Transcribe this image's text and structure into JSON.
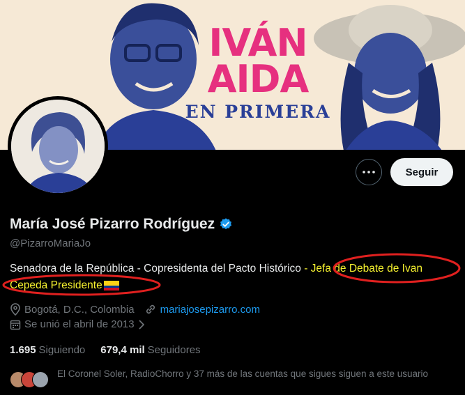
{
  "banner": {
    "line1": "IVÁN",
    "line2": "AIDA",
    "line3": "EN PRIMERA"
  },
  "actions": {
    "more_icon": "ellipsis-icon",
    "follow_label": "Seguir"
  },
  "profile": {
    "name": "María José Pizarro Rodríguez",
    "handle": "@PizarroMariaJo",
    "bio_plain": "Senadora de la República - Copresidenta del Pacto Histórico",
    "bio_highlight": " - Jefa de Debate de Ivan Cepeda Presidente",
    "location": "Bogotá, D.C., Colombia",
    "website": "mariajosepizarro.com",
    "joined": "Se unió el abril de 2013"
  },
  "stats": {
    "following_count": "1.695",
    "following_label": "Siguiendo",
    "followers_count": "679,4 mil",
    "followers_label": "Seguidores"
  },
  "followed_by": "El Coronel Soler, RadioChorro y 37 más de las cuentas que sigues siguen a este usuario",
  "colors": {
    "accent": "#1d9bf0",
    "highlight": "#f6f22f",
    "annotation": "#e0201f",
    "banner_pink": "#e6307f",
    "banner_blue": "#2a3f97"
  }
}
